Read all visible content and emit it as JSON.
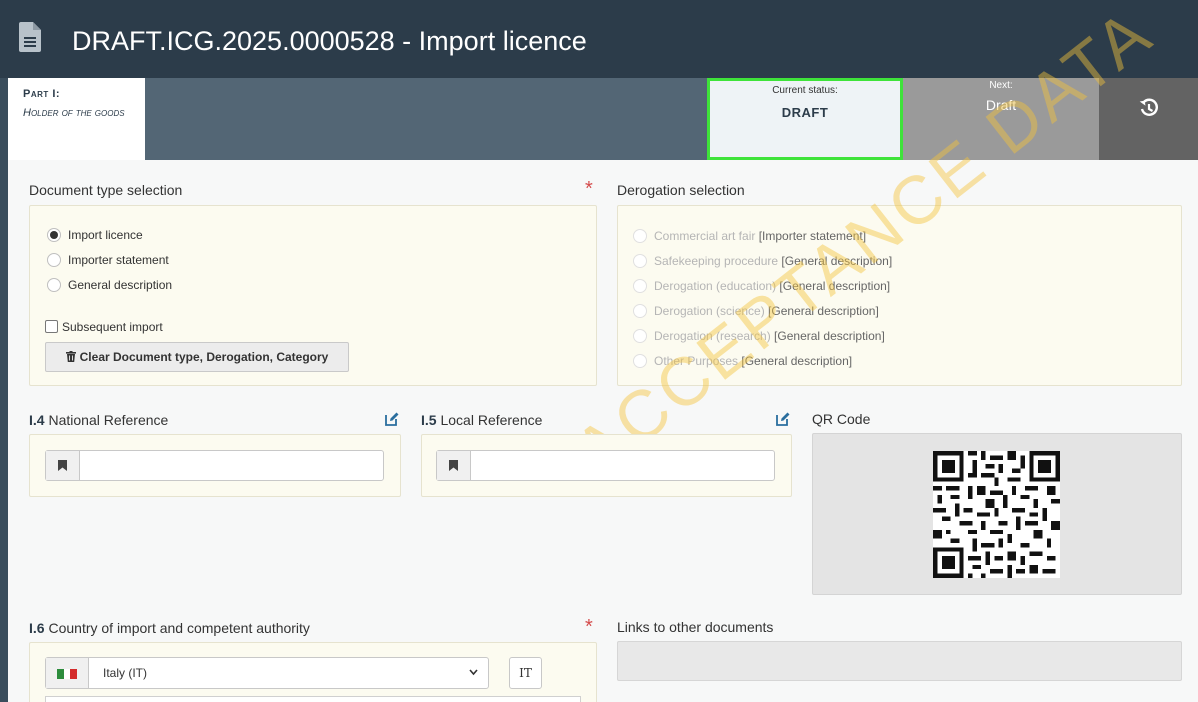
{
  "header": {
    "title": "DRAFT.ICG.2025.0000528 - Import licence",
    "icon": "document-icon"
  },
  "status_bar": {
    "part_title": "Part I:",
    "part_subtitle": "Holder of the goods",
    "current_label": "Current status:",
    "current_value": "DRAFT",
    "next_label": "Next:",
    "next_value": "Draft",
    "history_icon": "history-icon"
  },
  "document_type": {
    "label": "Document type selection",
    "options": [
      "Import licence",
      "Importer statement",
      "General description"
    ],
    "selected": "Import licence",
    "subsequent_import_label": "Subsequent import",
    "clear_button_label": "Clear Document type, Derogation, Category"
  },
  "derogation": {
    "label": "Derogation selection",
    "options": [
      {
        "main": "Commercial art fair",
        "suffix": " [Importer statement]"
      },
      {
        "main": "Safekeeping procedure",
        "suffix": " [General description]"
      },
      {
        "main": "Derogation (education)",
        "suffix": " [General description]"
      },
      {
        "main": "Derogation (science)",
        "suffix": " [General description]"
      },
      {
        "main": "Derogation (research)",
        "suffix": " [General description]"
      },
      {
        "main": "Other Purposes",
        "suffix": " [General description]"
      }
    ]
  },
  "national_reference": {
    "number": "I.4",
    "label": "National Reference",
    "value": ""
  },
  "local_reference": {
    "number": "I.5",
    "label": "Local Reference",
    "value": ""
  },
  "qr": {
    "label": "QR Code"
  },
  "country": {
    "number": "I.6",
    "label": "Country of import and competent authority",
    "selected": "Italy (IT)",
    "iso_button": "IT"
  },
  "links": {
    "label": "Links to other documents"
  },
  "watermark": {
    "text": "ACCEPTANCE DATA"
  },
  "colors": {
    "header_bg": "#2c3c4a",
    "status_highlight": "#3ee33a",
    "required": "#d44b4b",
    "panel_bg": "#fcfbf0"
  }
}
